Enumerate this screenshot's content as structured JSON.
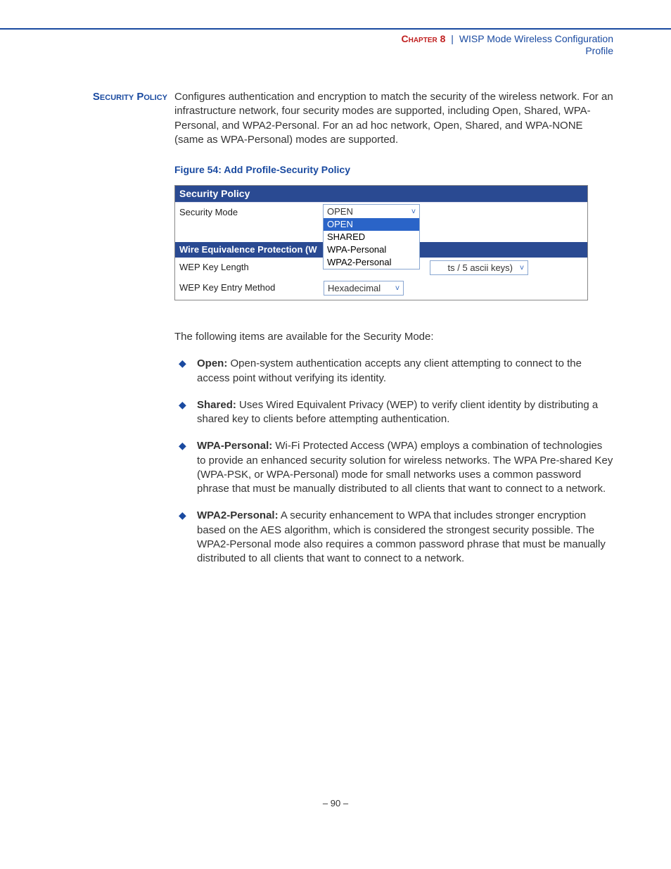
{
  "header": {
    "chapter_label": "Chapter 8",
    "separator": "|",
    "chapter_title": "WISP Mode Wireless Configuration",
    "subtitle": "Profile"
  },
  "side_heading": "Security Policy",
  "intro_paragraph": "Configures authentication and encryption to match the security of the wireless network. For an infrastructure network, four security modes are supported, including Open, Shared, WPA-Personal, and WPA2-Personal. For an ad hoc network, Open, Shared, and WPA-NONE (same as WPA-Personal) modes are supported.",
  "figure_caption": "Figure 54:  Add Profile-Security Policy",
  "figure": {
    "panel_title": "Security Policy",
    "security_mode_label": "Security Mode",
    "security_mode_value": "OPEN",
    "security_mode_options": [
      "OPEN",
      "SHARED",
      "WPA-Personal",
      "WPA2-Personal"
    ],
    "wep_section_title": "Wire Equivalence Protection (W",
    "wep_key_length_label": "WEP Key Length",
    "wep_key_length_value_fragment": "ts / 5 ascii keys)",
    "wep_key_entry_label": "WEP Key Entry Method",
    "wep_key_entry_value": "Hexadecimal"
  },
  "after_text": "The following items are available for the Security Mode:",
  "items": [
    {
      "term": "Open:",
      "desc": " Open-system authentication accepts any client attempting to connect to the access point without verifying its identity."
    },
    {
      "term": "Shared:",
      "desc": " Uses Wired Equivalent Privacy (WEP) to verify client identity by distributing a shared key to clients before attempting authentication."
    },
    {
      "term": "WPA-Personal:",
      "desc": " Wi-Fi Protected Access (WPA) employs a combination of technologies to provide an enhanced security solution for wireless networks. The WPA Pre-shared Key (WPA-PSK, or WPA-Personal) mode for small networks uses a common password phrase that must be manually distributed to all clients that want to connect to a network."
    },
    {
      "term": "WPA2-Personal:",
      "desc": " A security enhancement to WPA that includes stronger encryption based on the AES algorithm, which is considered the strongest security possible. The WPA2-Personal mode also requires a common password phrase that must be manually distributed to all clients that want to connect to a network."
    }
  ],
  "page_number": "–  90  –"
}
